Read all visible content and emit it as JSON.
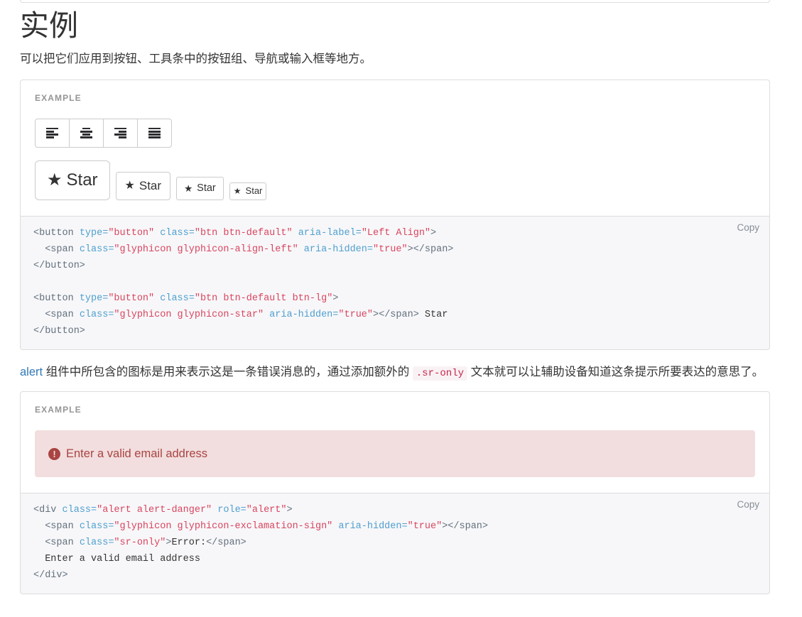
{
  "page": {
    "title": "实例",
    "lead": "可以把它们应用到按钮、工具条中的按钮组、导航或输入框等地方。"
  },
  "example_label": "EXAMPLE",
  "copy_label": "Copy",
  "align_button_group": {
    "buttons": [
      {
        "aria_label": "Left Align",
        "icon": "align-left-icon"
      },
      {
        "aria_label": "Center Align",
        "icon": "align-center-icon"
      },
      {
        "aria_label": "Right Align",
        "icon": "align-right-icon"
      },
      {
        "aria_label": "Justify",
        "icon": "align-justify-icon"
      }
    ]
  },
  "star_buttons": [
    {
      "label": "Star",
      "size": "btn-lg",
      "icon": "star-icon"
    },
    {
      "label": "Star",
      "size": "btn-default",
      "icon": "star-icon"
    },
    {
      "label": "Star",
      "size": "btn-sm",
      "icon": "star-icon"
    },
    {
      "label": "Star",
      "size": "btn-xs",
      "icon": "star-icon"
    }
  ],
  "code_block_1": {
    "lines": [
      [
        {
          "t": "tag",
          "v": "<button "
        },
        {
          "t": "attr",
          "v": "type="
        },
        {
          "t": "str",
          "v": "\"button\" "
        },
        {
          "t": "attr",
          "v": "class="
        },
        {
          "t": "str",
          "v": "\"btn btn-default\" "
        },
        {
          "t": "attr",
          "v": "aria-label="
        },
        {
          "t": "str",
          "v": "\"Left Align\""
        },
        {
          "t": "tag",
          "v": ">"
        }
      ],
      [
        {
          "t": "tag",
          "v": "  <span "
        },
        {
          "t": "attr",
          "v": "class="
        },
        {
          "t": "str",
          "v": "\"glyphicon glyphicon-align-left\" "
        },
        {
          "t": "attr",
          "v": "aria-hidden="
        },
        {
          "t": "str",
          "v": "\"true\""
        },
        {
          "t": "tag",
          "v": "></span>"
        }
      ],
      [
        {
          "t": "tag",
          "v": "</button>"
        }
      ],
      [
        {
          "t": "txt",
          "v": ""
        }
      ],
      [
        {
          "t": "tag",
          "v": "<button "
        },
        {
          "t": "attr",
          "v": "type="
        },
        {
          "t": "str",
          "v": "\"button\" "
        },
        {
          "t": "attr",
          "v": "class="
        },
        {
          "t": "str",
          "v": "\"btn btn-default btn-lg\""
        },
        {
          "t": "tag",
          "v": ">"
        }
      ],
      [
        {
          "t": "tag",
          "v": "  <span "
        },
        {
          "t": "attr",
          "v": "class="
        },
        {
          "t": "str",
          "v": "\"glyphicon glyphicon-star\" "
        },
        {
          "t": "attr",
          "v": "aria-hidden="
        },
        {
          "t": "str",
          "v": "\"true\""
        },
        {
          "t": "tag",
          "v": "></span>"
        },
        {
          "t": "txt",
          "v": " Star"
        }
      ],
      [
        {
          "t": "tag",
          "v": "</button>"
        }
      ]
    ]
  },
  "paragraph_2": {
    "link_text": "alert",
    "part_1": " 组件中所包含的图标是用来表示这是一条错误消息的，通过添加额外的 ",
    "code": ".sr-only",
    "part_2": " 文本就可以让辅助设备知道这条提示所要表达的意思了。"
  },
  "alert": {
    "icon": "exclamation-sign-icon",
    "icon_glyph": "!",
    "message": "Enter a valid email address",
    "bg_color": "#f2dede",
    "text_color": "#a94442"
  },
  "code_block_2": {
    "lines": [
      [
        {
          "t": "tag",
          "v": "<div "
        },
        {
          "t": "attr",
          "v": "class="
        },
        {
          "t": "str",
          "v": "\"alert alert-danger\" "
        },
        {
          "t": "attr",
          "v": "role="
        },
        {
          "t": "str",
          "v": "\"alert\""
        },
        {
          "t": "tag",
          "v": ">"
        }
      ],
      [
        {
          "t": "tag",
          "v": "  <span "
        },
        {
          "t": "attr",
          "v": "class="
        },
        {
          "t": "str",
          "v": "\"glyphicon glyphicon-exclamation-sign\" "
        },
        {
          "t": "attr",
          "v": "aria-hidden="
        },
        {
          "t": "str",
          "v": "\"true\""
        },
        {
          "t": "tag",
          "v": "></span>"
        }
      ],
      [
        {
          "t": "tag",
          "v": "  <span "
        },
        {
          "t": "attr",
          "v": "class="
        },
        {
          "t": "str",
          "v": "\"sr-only\""
        },
        {
          "t": "tag",
          "v": ">"
        },
        {
          "t": "txt",
          "v": "Error:"
        },
        {
          "t": "tag",
          "v": "</span>"
        }
      ],
      [
        {
          "t": "txt",
          "v": "  Enter a valid email address"
        }
      ],
      [
        {
          "t": "tag",
          "v": "</div>"
        }
      ]
    ]
  },
  "colors": {
    "border": "#dddddd",
    "code_bg": "#f7f7f9",
    "link": "#337ab7",
    "inline_code_text": "#c7254e",
    "inline_code_bg": "#f9f2f4",
    "example_label": "#959595"
  }
}
